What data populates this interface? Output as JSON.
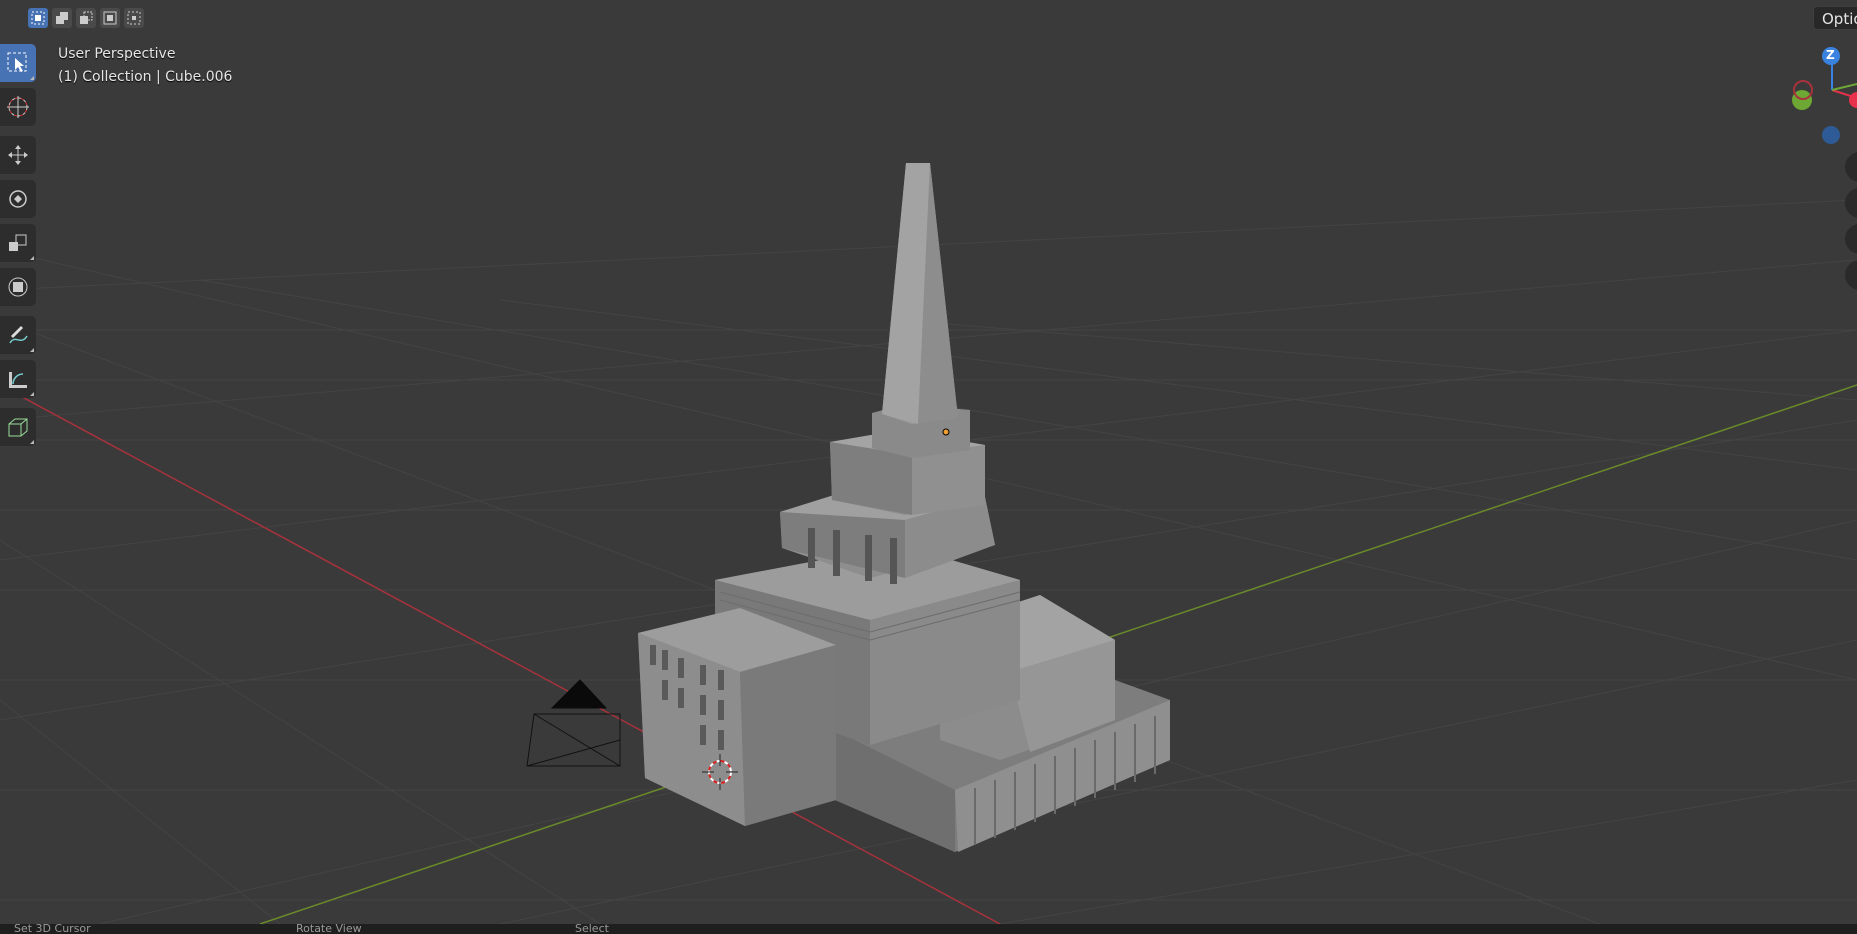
{
  "viewport": {
    "view_name": "User Perspective",
    "collection_info": "(1) Collection | Cube.006",
    "options_label": "Options"
  },
  "header": {
    "select_modes": [
      {
        "icon": "select-new-icon",
        "active": true
      },
      {
        "icon": "select-extend-icon",
        "active": false
      },
      {
        "icon": "select-subtract-icon",
        "active": false
      },
      {
        "icon": "select-invert-icon",
        "active": false
      },
      {
        "icon": "select-intersect-icon",
        "active": false
      }
    ]
  },
  "toolbar": {
    "tools": [
      "select-box-icon",
      "cursor-icon",
      "move-icon",
      "rotate-icon",
      "scale-icon",
      "transform-icon",
      "annotate-icon",
      "measure-icon",
      "add-cube-icon"
    ]
  },
  "gizmo": {
    "z_label": "Z",
    "x_label": "X",
    "colors": {
      "x": "#e8314b",
      "y": "#6ea834",
      "z": "#3a82e0"
    }
  },
  "statusbar": {
    "items": [
      "Set 3D Cursor",
      "Rotate View",
      "Select"
    ]
  },
  "colors": {
    "background": "#3a3a3a",
    "grid": "#434343",
    "x_axis": "#a8323c",
    "y_axis": "#6a8a2a",
    "accent": "#4772b3"
  }
}
